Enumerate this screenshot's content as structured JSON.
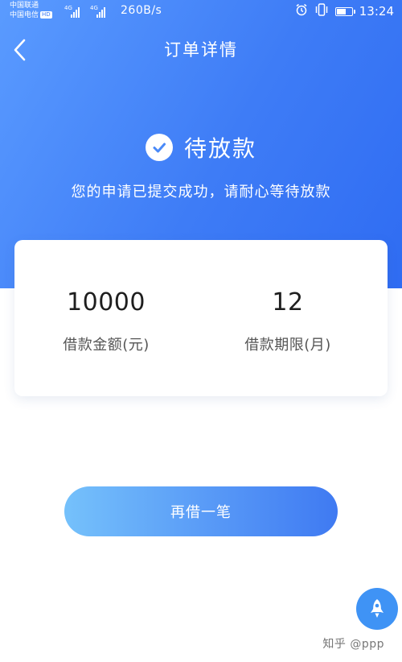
{
  "status_bar": {
    "carrier_1": "中国联通",
    "carrier_2": "中国电信",
    "hd_badge": "HD",
    "network_1": "4G",
    "network_2": "4G",
    "net_speed": "260B/s",
    "time": "13:24",
    "icons": [
      "alarm-clock-icon",
      "vibrate-icon",
      "battery-icon"
    ]
  },
  "navbar": {
    "title": "订单详情",
    "back_icon": "chevron-left-icon"
  },
  "status": {
    "icon": "check-circle-icon",
    "title": "待放款",
    "subtitle": "您的申请已提交成功，请耐心等待放款"
  },
  "loan": {
    "amount_value": "10000",
    "amount_label": "借款金额(元)",
    "term_value": "12",
    "term_label": "借款期限(月)"
  },
  "actions": {
    "borrow_again": "再借一笔"
  },
  "floating": {
    "icon": "rocket-icon"
  },
  "watermark": {
    "text": "知乎 @ppp"
  },
  "colors": {
    "header_gradient_start": "#5a9bff",
    "header_gradient_end": "#2f6cf2",
    "button_gradient_start": "#75c1fb",
    "button_gradient_end": "#3f7af2",
    "fab": "#3f93f5"
  }
}
